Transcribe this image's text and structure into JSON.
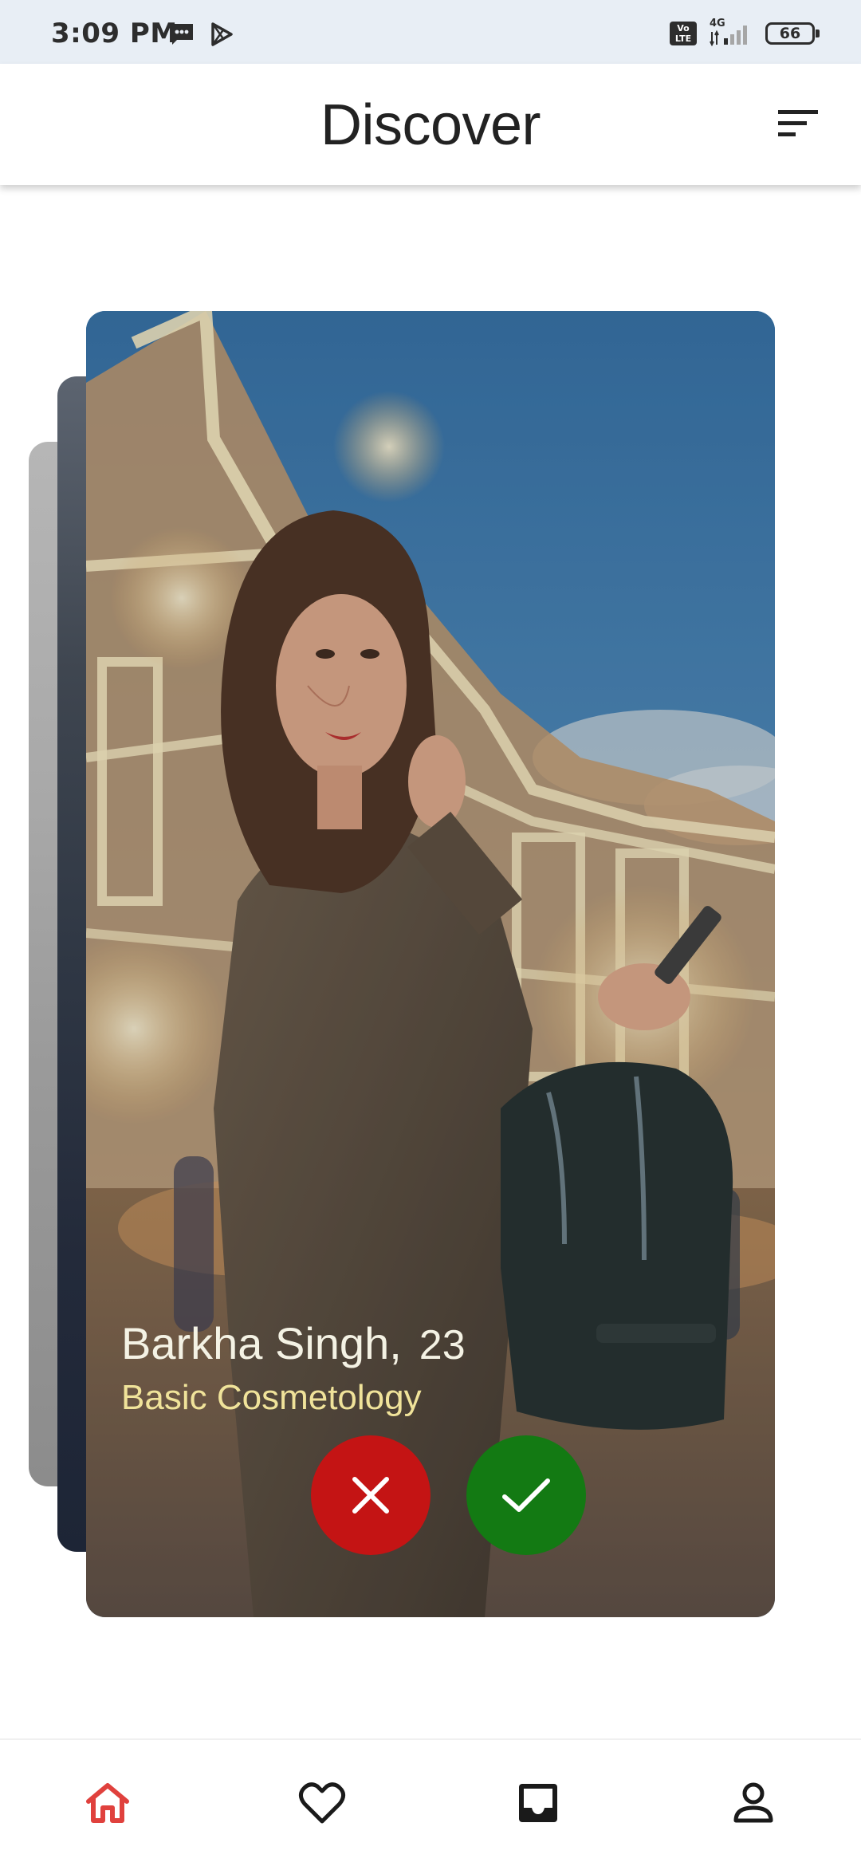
{
  "status_bar": {
    "time": "3:09 PM",
    "network": "4G",
    "volte": "Vo LTE",
    "battery": "66"
  },
  "header": {
    "title": "Discover"
  },
  "profile": {
    "name": "Barkha Singh,",
    "age": "23",
    "course": "Basic Cosmetology"
  },
  "colors": {
    "reject": "#c41414",
    "accept": "#137a13",
    "active_nav": "#e0413d",
    "text_dark": "#222222"
  },
  "icons": {
    "filter": "filter-icon",
    "reject": "close-icon",
    "accept": "check-icon",
    "home": "home-icon",
    "likes": "heart-icon",
    "inbox": "inbox-icon",
    "profile": "person-icon"
  },
  "bottom_nav": {
    "active": "home"
  }
}
